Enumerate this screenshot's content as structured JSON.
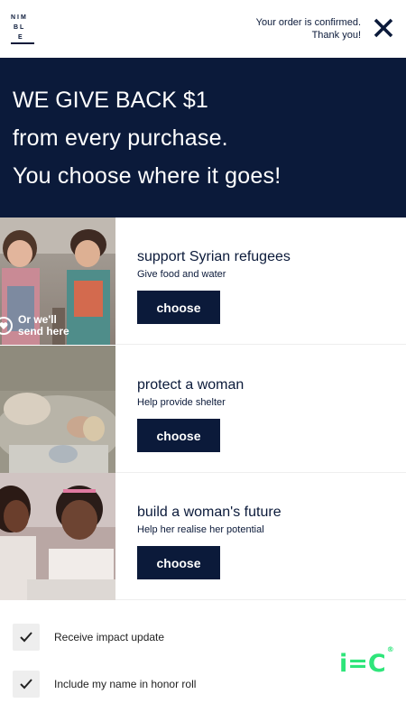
{
  "header": {
    "logo": {
      "line1": "NIM",
      "line2": "BL",
      "line3": "E"
    },
    "confirmation_line1": "Your order is confirmed.",
    "confirmation_line2": "Thank you!"
  },
  "banner": {
    "line1": "WE GIVE BACK $1",
    "line2": "from every purchase.",
    "line3": "You choose where it goes!"
  },
  "causes": [
    {
      "title": "support Syrian refugees",
      "subtitle": "Give food and water",
      "button_label": "choose",
      "default_badge_line1": "Or we'll",
      "default_badge_line2": "send here"
    },
    {
      "title": "protect a woman",
      "subtitle": "Help provide shelter",
      "button_label": "choose"
    },
    {
      "title": "build a woman's future",
      "subtitle": "Help her realise her potential",
      "button_label": "choose"
    }
  ],
  "options": [
    {
      "label": "Receive impact update",
      "checked": true
    },
    {
      "label": "Include my name in honor roll",
      "checked": true
    }
  ],
  "brand": {
    "text": "i=C",
    "mark": "®",
    "color": "#2ee57a"
  },
  "colors": {
    "navy": "#0b1a3a",
    "white": "#ffffff"
  }
}
